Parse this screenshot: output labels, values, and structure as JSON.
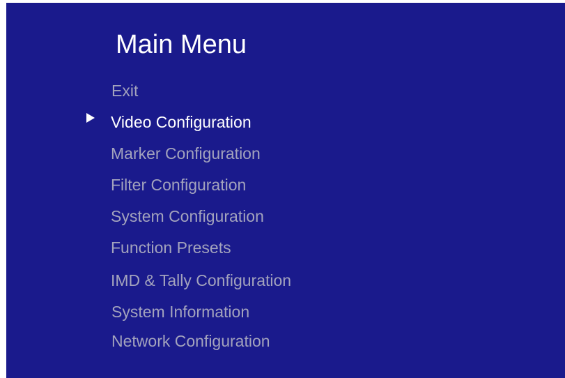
{
  "menu": {
    "title": "Main Menu",
    "items": [
      {
        "label": "Exit",
        "selected": false
      },
      {
        "label": "Video Configuration",
        "selected": true
      },
      {
        "label": "Marker Configuration",
        "selected": false
      },
      {
        "label": "Filter Configuration",
        "selected": false
      },
      {
        "label": "System Configuration",
        "selected": false
      },
      {
        "label": "Function Presets",
        "selected": false
      },
      {
        "label": "IMD & Tally Configuration",
        "selected": false
      },
      {
        "label": "System Information",
        "selected": false
      },
      {
        "label": "Network Configuration",
        "selected": false
      }
    ],
    "cursor_icon": "right-triangle-icon"
  },
  "colors": {
    "background": "#1a1a8c",
    "title": "#ffffff",
    "selected_item": "#ffffff",
    "unselected_item": "#a3a3bd"
  }
}
